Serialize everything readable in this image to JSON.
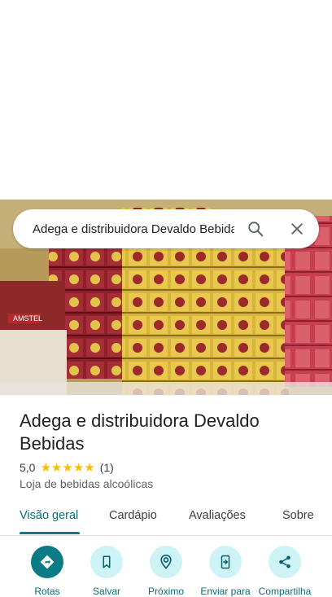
{
  "search": {
    "query": "Adega e distribuidora Devaldo Bebidas"
  },
  "place": {
    "name": "Adega e distribuidora Devaldo Bebidas",
    "rating": "5,0",
    "stars": 5,
    "review_count": "(1)",
    "category": "Loja de bebidas alcoólicas"
  },
  "tabs": [
    {
      "label": "Visão geral",
      "active": true
    },
    {
      "label": "Cardápio"
    },
    {
      "label": "Avaliações"
    },
    {
      "label": "Sobre"
    }
  ],
  "actions": [
    {
      "label": "Rotas",
      "icon": "directions-icon"
    },
    {
      "label": "Salvar",
      "icon": "bookmark-icon"
    },
    {
      "label": "Próximo",
      "icon": "nearby-icon"
    },
    {
      "label": "Enviar para",
      "icon": "send-to-phone-icon"
    },
    {
      "label": "Compartilha",
      "icon": "share-icon"
    }
  ],
  "photo": {
    "brand_text": "AMSTEL"
  },
  "colors": {
    "accent": "#0b7b86",
    "action_bg": "#cdf3f7",
    "star": "#fbbc04"
  }
}
